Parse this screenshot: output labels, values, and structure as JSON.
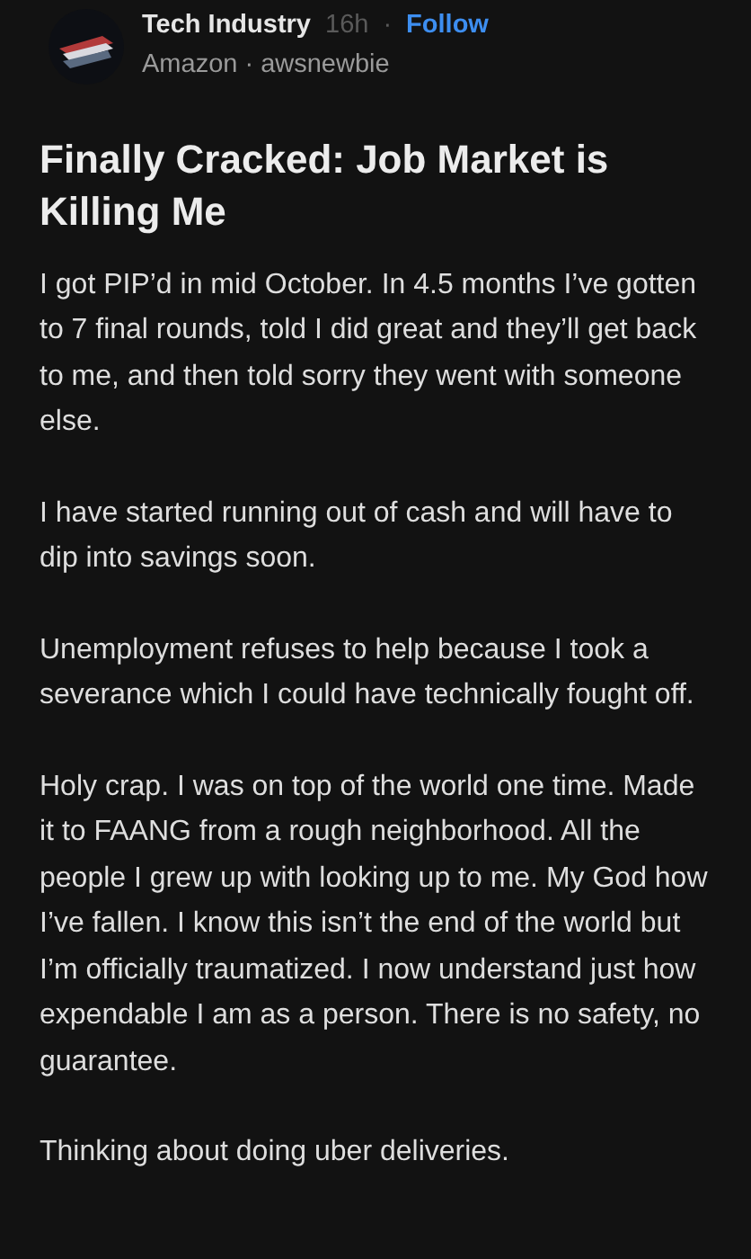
{
  "post": {
    "channel": "Tech Industry",
    "time": "16h",
    "separator": "·",
    "follow": "Follow",
    "company": "Amazon · awsnewbie",
    "title": "Finally Cracked: Job Market is Killing Me",
    "paragraphs": [
      "I got PIP’d in mid October. In 4.5 months I’ve gotten to 7 final rounds, told I did great and they’ll get back to me, and then told sorry they went with someone else.",
      "I have started running out of cash and will have to dip into savings soon.",
      "Unemployment refuses to help because I took a severance which I could have technically fought off.",
      "Holy crap. I was on top of the world one time. Made it to FAANG from a rough neighborhood. All the people I grew up with looking up to me. My God how I’ve fallen. I know this isn’t the end of the world but I’m officially traumatized. I now understand just how expendable I am as a person. There is no safety, no guarantee.",
      "Thinking about doing uber deliveries."
    ]
  }
}
